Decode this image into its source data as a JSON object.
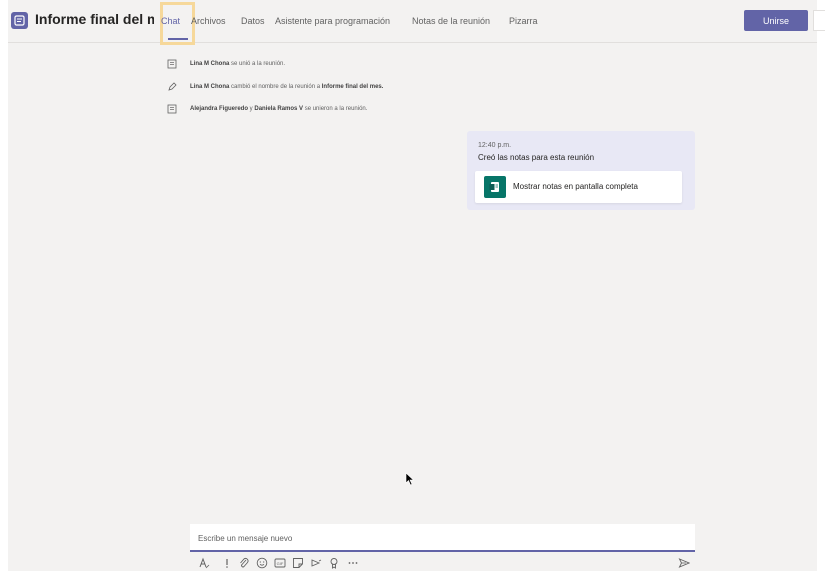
{
  "header": {
    "title": "Informe final del mes",
    "tabs": [
      {
        "label": "Chat",
        "active": true
      },
      {
        "label": "Archivos"
      },
      {
        "label": "Datos"
      },
      {
        "label": "Asistente para programación"
      },
      {
        "label": "Notas de la reunión"
      },
      {
        "label": "Pizarra"
      }
    ],
    "join_label": "Unirse",
    "accent_color": "#6264a7",
    "highlight_color": "#f6d89a"
  },
  "system_messages": [
    {
      "icon": "participant-join-icon",
      "actor": "Lina M Chona",
      "text": " se unió a la reunión."
    },
    {
      "icon": "edit-pencil-icon",
      "actor": "Lina M Chona",
      "text": " cambió el nombre de la reunión a ",
      "target": "Informe final del mes."
    },
    {
      "icon": "participant-join-icon",
      "actor": "Alejandra Figueredo",
      "connector": " y ",
      "actor2": "Daniela Ramos V",
      "text": " se unieron a la reunión."
    }
  ],
  "notes_message": {
    "time": "12:40 p.m.",
    "text": "Creó las notas para esta reunión",
    "card_label": "Mostrar notas en pantalla completa",
    "card_icon": "notes-icon",
    "card_icon_color": "#077568"
  },
  "compose": {
    "placeholder": "Escribe un mensaje nuevo",
    "tools": [
      "format-icon",
      "important-icon",
      "attach-icon",
      "emoji-icon",
      "gif-icon",
      "sticker-icon",
      "meet-now-icon",
      "praise-icon",
      "more-options-icon"
    ],
    "send_icon": "send-icon"
  }
}
